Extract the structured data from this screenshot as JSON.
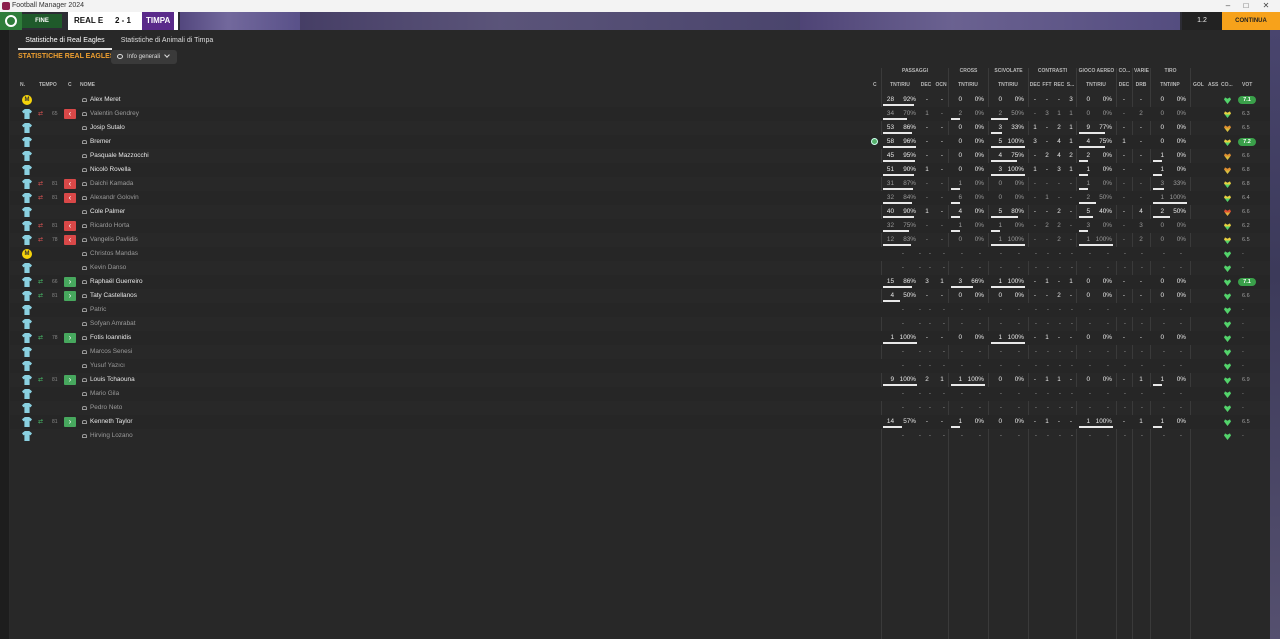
{
  "window": {
    "title": "Football Manager 2024"
  },
  "topbar": {
    "end_match_label": "FINE PARTITA",
    "home_team": "REAL E",
    "score": "2 - 1",
    "away_team": "TIMPA",
    "time_label": "1.2",
    "continue_label": "CONTINUA"
  },
  "tabs": [
    {
      "label": "Statistiche di Real Eagles"
    },
    {
      "label": "Statistiche di Animali di Timpa"
    }
  ],
  "section_title": "STATISTICHE REAL EAGLES",
  "view_dropdown": {
    "label": "Info generali",
    "icon": "eye-icon"
  },
  "group_headers": [
    "PASSAGGI",
    "CROSS",
    "SCIVOLATE",
    "CONTRASTI",
    "GIOCO AEREO",
    "CO...",
    "VARIE",
    "TIRO"
  ],
  "column_headers": {
    "num": "N.",
    "time": "TEMPO",
    "c": "C",
    "name": "NOME",
    "c2": "C",
    "pass": "TNT/RIU",
    "dec": "DEC",
    "ocn": "OCN",
    "cross": "TNT/RIU",
    "tackle": "TNT/RIU",
    "cdec": "DEC",
    "fft": "FFT",
    "rec": "REC",
    "s": "S...",
    "aerial": "TNT/RIU",
    "adec": "DEC",
    "drb": "DRB",
    "shot": "TNT/INP",
    "gol": "GOL",
    "ass": "ASS",
    "co": "CO...",
    "vot": "VOT"
  },
  "colors": {
    "accent_orange": "#f0a030",
    "sub_out": "#d94848",
    "sub_in": "#47a85e",
    "rating_green": "#3aa04a"
  },
  "players": [
    {
      "name": "Alex Meret",
      "gk": true,
      "gk_label": "M",
      "sub": "",
      "time": "",
      "active": true,
      "pass": [
        "28",
        "92%"
      ],
      "dec": "-",
      "ocn": "-",
      "cross": [
        "0",
        "0%"
      ],
      "tackle": [
        "0",
        "0%"
      ],
      "cdec": "-",
      "fft": "-",
      "rec": "-",
      "s": "3",
      "aerial": [
        "0",
        "0%"
      ],
      "adec": "-",
      "drb": "-",
      "shot": [
        "0",
        "0%"
      ],
      "cond": "full",
      "rating": "7.1",
      "mot": false
    },
    {
      "name": "Valentin Gendrey",
      "sub": "out",
      "time": "65",
      "active": false,
      "pass": [
        "34",
        "70%"
      ],
      "dec": "1",
      "ocn": "-",
      "cross": [
        "2",
        "0%"
      ],
      "tackle": [
        "2",
        "50%"
      ],
      "cdec": "-",
      "fft": "3",
      "rec": "1",
      "s": "1",
      "aerial": [
        "0",
        "0%"
      ],
      "adec": "-",
      "drb": "2",
      "shot": [
        "0",
        "0%"
      ],
      "cond": "mix",
      "rating": "6.3",
      "mot": false
    },
    {
      "name": "Josip Sutalo",
      "sub": "",
      "time": "",
      "active": true,
      "pass": [
        "53",
        "86%"
      ],
      "dec": "-",
      "ocn": "-",
      "cross": [
        "0",
        "0%"
      ],
      "tackle": [
        "3",
        "33%"
      ],
      "cdec": "1",
      "fft": "-",
      "rec": "2",
      "s": "1",
      "aerial": [
        "9",
        "77%"
      ],
      "adec": "-",
      "drb": "-",
      "shot": [
        "0",
        "0%"
      ],
      "cond": "mix2",
      "rating": "6.5",
      "mot": false
    },
    {
      "name": "Bremer",
      "sub": "",
      "time": "",
      "active": true,
      "pass": [
        "58",
        "96%"
      ],
      "dec": "-",
      "ocn": "-",
      "cross": [
        "0",
        "0%"
      ],
      "tackle": [
        "5",
        "100%"
      ],
      "cdec": "3",
      "fft": "-",
      "rec": "4",
      "s": "1",
      "aerial": [
        "4",
        "75%"
      ],
      "adec": "1",
      "drb": "-",
      "shot": [
        "0",
        "0%"
      ],
      "cond": "mix",
      "rating": "7.2",
      "mot": true
    },
    {
      "name": "Pasquale Mazzocchi",
      "sub": "",
      "time": "",
      "active": true,
      "pass": [
        "45",
        "95%"
      ],
      "dec": "-",
      "ocn": "-",
      "cross": [
        "0",
        "0%"
      ],
      "tackle": [
        "4",
        "75%"
      ],
      "cdec": "-",
      "fft": "2",
      "rec": "4",
      "s": "2",
      "aerial": [
        "2",
        "0%"
      ],
      "adec": "-",
      "drb": "-",
      "shot": [
        "1",
        "0%"
      ],
      "cond": "mix2",
      "rating": "6.6",
      "mot": false
    },
    {
      "name": "Nicolò Rovella",
      "sub": "",
      "time": "",
      "active": true,
      "pass": [
        "51",
        "90%"
      ],
      "dec": "1",
      "ocn": "-",
      "cross": [
        "0",
        "0%"
      ],
      "tackle": [
        "3",
        "100%"
      ],
      "cdec": "1",
      "fft": "-",
      "rec": "3",
      "s": "1",
      "aerial": [
        "1",
        "0%"
      ],
      "adec": "-",
      "drb": "-",
      "shot": [
        "1",
        "0%"
      ],
      "cond": "mix2",
      "rating": "6.8",
      "mot": false
    },
    {
      "name": "Daichi Kamada",
      "sub": "out",
      "time": "81",
      "active": false,
      "pass": [
        "31",
        "87%"
      ],
      "dec": "-",
      "ocn": "-",
      "cross": [
        "1",
        "0%"
      ],
      "tackle": [
        "0",
        "0%"
      ],
      "cdec": "-",
      "fft": "-",
      "rec": "-",
      "s": "-",
      "aerial": [
        "1",
        "0%"
      ],
      "adec": "-",
      "drb": "-",
      "shot": [
        "3",
        "33%"
      ],
      "cond": "mix",
      "rating": "6.8",
      "mot": false
    },
    {
      "name": "Alexandr Golovin",
      "sub": "out",
      "time": "81",
      "active": false,
      "pass": [
        "32",
        "84%"
      ],
      "dec": "-",
      "ocn": "-",
      "cross": [
        "6",
        "0%"
      ],
      "tackle": [
        "0",
        "0%"
      ],
      "cdec": "-",
      "fft": "1",
      "rec": "-",
      "s": "-",
      "aerial": [
        "2",
        "50%"
      ],
      "adec": "-",
      "drb": "-",
      "shot": [
        "1",
        "100%"
      ],
      "cond": "mix",
      "rating": "6.4",
      "mot": false
    },
    {
      "name": "Cole Palmer",
      "sub": "",
      "time": "",
      "active": true,
      "pass": [
        "40",
        "90%"
      ],
      "dec": "1",
      "ocn": "-",
      "cross": [
        "4",
        "0%"
      ],
      "tackle": [
        "5",
        "80%"
      ],
      "cdec": "-",
      "fft": "-",
      "rec": "2",
      "s": "-",
      "aerial": [
        "5",
        "40%"
      ],
      "adec": "-",
      "drb": "4",
      "shot": [
        "2",
        "50%"
      ],
      "cond": "mix3",
      "rating": "6.6",
      "mot": false
    },
    {
      "name": "Ricardo Horta",
      "sub": "out",
      "time": "81",
      "active": false,
      "pass": [
        "32",
        "75%"
      ],
      "dec": "-",
      "ocn": "-",
      "cross": [
        "1",
        "0%"
      ],
      "tackle": [
        "1",
        "0%"
      ],
      "cdec": "-",
      "fft": "2",
      "rec": "2",
      "s": "-",
      "aerial": [
        "3",
        "0%"
      ],
      "adec": "-",
      "drb": "3",
      "shot": [
        "0",
        "0%"
      ],
      "cond": "mix",
      "rating": "6.2",
      "mot": false
    },
    {
      "name": "Vangelis Pavlidis",
      "sub": "out",
      "time": "78",
      "active": false,
      "pass": [
        "12",
        "83%"
      ],
      "dec": "-",
      "ocn": "-",
      "cross": [
        "0",
        "0%"
      ],
      "tackle": [
        "1",
        "100%"
      ],
      "cdec": "-",
      "fft": "-",
      "rec": "2",
      "s": "-",
      "aerial": [
        "1",
        "100%"
      ],
      "adec": "-",
      "drb": "2",
      "shot": [
        "0",
        "0%"
      ],
      "cond": "mix",
      "rating": "6.5",
      "mot": false
    },
    {
      "name": "Christos Mandas",
      "gk": true,
      "gk_label": "M",
      "sub": "",
      "time": "",
      "active": false,
      "empty": true,
      "cond": "full",
      "rating": "-"
    },
    {
      "name": "Kevin Danso",
      "sub": "",
      "time": "",
      "active": false,
      "empty": true,
      "cond": "full",
      "rating": "-"
    },
    {
      "name": "Raphaël Guerreiro",
      "sub": "in",
      "time": "66",
      "active": true,
      "pass": [
        "15",
        "86%"
      ],
      "dec": "3",
      "ocn": "1",
      "cross": [
        "3",
        "66%"
      ],
      "tackle": [
        "1",
        "100%"
      ],
      "cdec": "-",
      "fft": "1",
      "rec": "-",
      "s": "1",
      "aerial": [
        "0",
        "0%"
      ],
      "adec": "-",
      "drb": "-",
      "shot": [
        "0",
        "0%"
      ],
      "cond": "full",
      "rating": "7.1",
      "mot": false
    },
    {
      "name": "Taty Castellanos",
      "sub": "in",
      "time": "81",
      "active": true,
      "pass": [
        "4",
        "50%"
      ],
      "dec": "-",
      "ocn": "-",
      "cross": [
        "0",
        "0%"
      ],
      "tackle": [
        "0",
        "0%"
      ],
      "cdec": "-",
      "fft": "-",
      "rec": "2",
      "s": "-",
      "aerial": [
        "0",
        "0%"
      ],
      "adec": "-",
      "drb": "-",
      "shot": [
        "0",
        "0%"
      ],
      "cond": "full",
      "rating": "6.6",
      "mot": false
    },
    {
      "name": "Patric",
      "sub": "",
      "time": "",
      "active": false,
      "empty": true,
      "cond": "full",
      "rating": "-"
    },
    {
      "name": "Sofyan Amrabat",
      "sub": "",
      "time": "",
      "active": false,
      "empty": true,
      "cond": "full",
      "rating": "-"
    },
    {
      "name": "Fotis Ioannidis",
      "sub": "in",
      "time": "78",
      "active": true,
      "pass": [
        "1",
        "100%"
      ],
      "dec": "-",
      "ocn": "-",
      "cross": [
        "0",
        "0%"
      ],
      "tackle": [
        "1",
        "100%"
      ],
      "cdec": "-",
      "fft": "1",
      "rec": "-",
      "s": "-",
      "aerial": [
        "0",
        "0%"
      ],
      "adec": "-",
      "drb": "-",
      "shot": [
        "0",
        "0%"
      ],
      "cond": "full",
      "rating": "-",
      "mot": false
    },
    {
      "name": "Marcos Senesi",
      "sub": "",
      "time": "",
      "active": false,
      "empty": true,
      "cond": "full",
      "rating": "-"
    },
    {
      "name": "Yusuf Yazıcı",
      "sub": "",
      "time": "",
      "active": false,
      "empty": true,
      "cond": "full",
      "rating": "-"
    },
    {
      "name": "Louis Tchaouna",
      "sub": "in",
      "time": "81",
      "active": true,
      "pass": [
        "9",
        "100%"
      ],
      "dec": "2",
      "ocn": "1",
      "cross": [
        "1",
        "100%"
      ],
      "tackle": [
        "0",
        "0%"
      ],
      "cdec": "-",
      "fft": "1",
      "rec": "1",
      "s": "-",
      "aerial": [
        "0",
        "0%"
      ],
      "adec": "-",
      "drb": "1",
      "shot": [
        "1",
        "0%"
      ],
      "cond": "full",
      "rating": "6.9",
      "mot": false
    },
    {
      "name": "Mario Gila",
      "sub": "",
      "time": "",
      "active": false,
      "empty": true,
      "cond": "full",
      "rating": "-"
    },
    {
      "name": "Pedro Neto",
      "sub": "",
      "time": "",
      "active": false,
      "empty": true,
      "cond": "full",
      "rating": "-"
    },
    {
      "name": "Kenneth Taylor",
      "sub": "in",
      "time": "81",
      "active": true,
      "pass": [
        "14",
        "57%"
      ],
      "dec": "-",
      "ocn": "-",
      "cross": [
        "1",
        "0%"
      ],
      "tackle": [
        "0",
        "0%"
      ],
      "cdec": "-",
      "fft": "1",
      "rec": "-",
      "s": "-",
      "aerial": [
        "1",
        "100%"
      ],
      "adec": "-",
      "drb": "1",
      "shot": [
        "1",
        "0%"
      ],
      "cond": "full",
      "rating": "6.5",
      "mot": false
    },
    {
      "name": "Hirving Lozano",
      "sub": "",
      "time": "",
      "active": false,
      "empty": true,
      "cond": "full",
      "rating": "-"
    }
  ]
}
